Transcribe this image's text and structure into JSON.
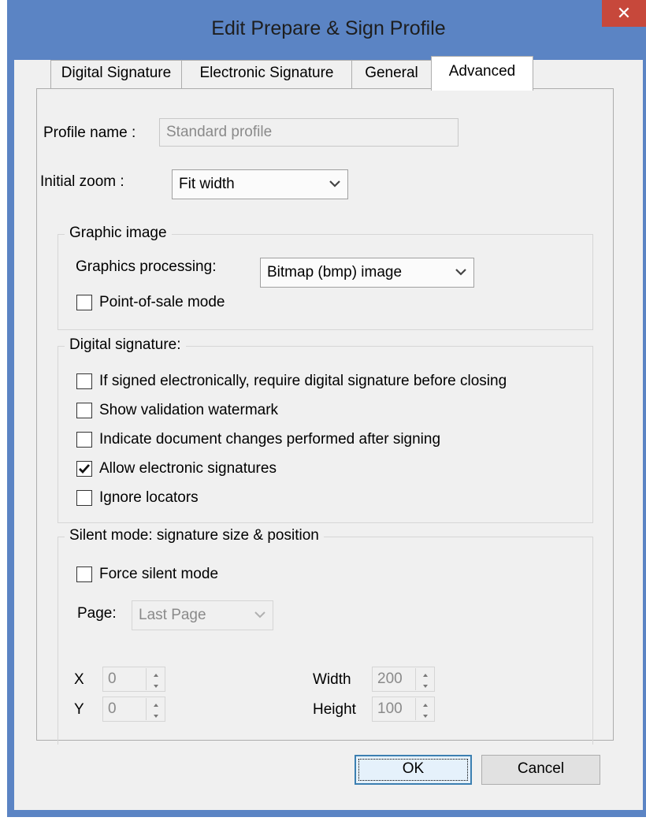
{
  "window": {
    "title": "Edit Prepare & Sign Profile",
    "close_glyph": "✕"
  },
  "tabs": [
    {
      "label": "Digital Signature"
    },
    {
      "label": "Electronic Signature"
    },
    {
      "label": "General"
    },
    {
      "label": "Advanced",
      "selected": true
    }
  ],
  "profile": {
    "label": "Profile name :",
    "value": "Standard profile"
  },
  "zoom": {
    "label": "Initial zoom :",
    "value": "Fit width"
  },
  "graphic": {
    "title": "Graphic image",
    "processing_label": "Graphics processing:",
    "processing_value": "Bitmap (bmp) image",
    "pos_label": "Point-of-sale mode",
    "pos_checked": false
  },
  "digital": {
    "title": "Digital signature:",
    "options": [
      {
        "label": "If signed electronically, require digital signature before closing",
        "checked": false
      },
      {
        "label": "Show validation watermark",
        "checked": false
      },
      {
        "label": "Indicate document changes performed after signing",
        "checked": false
      },
      {
        "label": "Allow electronic signatures",
        "checked": true
      },
      {
        "label": "Ignore locators",
        "checked": false
      }
    ]
  },
  "silent": {
    "title": "Silent mode: signature size & position",
    "force_label": "Force silent mode",
    "force_checked": false,
    "page_label": "Page:",
    "page_value": "Last Page",
    "x_label": "X",
    "x_value": "0",
    "y_label": "Y",
    "y_value": "0",
    "width_label": "Width",
    "width_value": "200",
    "height_label": "Height",
    "height_value": "100"
  },
  "buttons": {
    "ok": "OK",
    "cancel": "Cancel"
  },
  "colors": {
    "titlebar": "#5b84c4",
    "close": "#c7483b",
    "client": "#f0f0f0"
  },
  "icons": {
    "close": "close-icon",
    "dropdown": "chevron-down-icon",
    "check": "checkmark-icon",
    "spin_up": "arrow-up-icon",
    "spin_down": "arrow-down-icon"
  }
}
